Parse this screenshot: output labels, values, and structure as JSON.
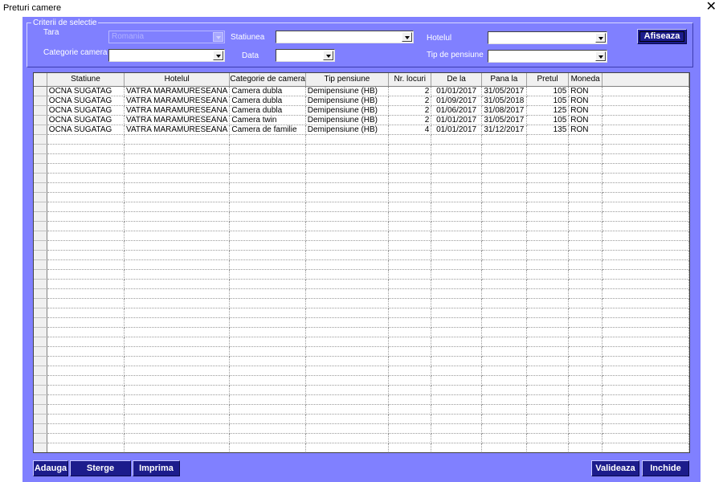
{
  "window": {
    "title": "Preturi camere"
  },
  "criteria": {
    "legend": "Criterii de selectie",
    "tara_label": "Tara",
    "tara_value": "Romania",
    "statiunea_label": "Statiunea",
    "statiunea_value": "",
    "hotelul_label": "Hotelul",
    "hotelul_value": "",
    "categorie_label": "Categorie camera",
    "categorie_value": "",
    "data_label": "Data",
    "data_value": "",
    "pensiune_label": "Tip de pensiune",
    "pensiune_value": "",
    "afiseaza_label": "Afiseaza"
  },
  "grid": {
    "columns": [
      "Statiune",
      "Hotelul",
      "Categorie de camera",
      "Tip pensiune",
      "Nr. locuri",
      "De la",
      "Pana la",
      "Pretul",
      "Moneda"
    ],
    "rows": [
      [
        "OCNA SUGATAG",
        "VATRA MARAMURESEANA",
        "Camera dubla",
        "Demipensiune (HB)",
        "2",
        "01/01/2017",
        "31/05/2017",
        "105",
        "RON"
      ],
      [
        "OCNA SUGATAG",
        "VATRA MARAMURESEANA",
        "Camera dubla",
        "Demipensiune (HB)",
        "2",
        "01/09/2017",
        "31/05/2018",
        "105",
        "RON"
      ],
      [
        "OCNA SUGATAG",
        "VATRA MARAMURESEANA",
        "Camera dubla",
        "Demipensiune (HB)",
        "2",
        "01/06/2017",
        "31/08/2017",
        "125",
        "RON"
      ],
      [
        "OCNA SUGATAG",
        "VATRA MARAMURESEANA",
        "Camera twin",
        "Demipensiune (HB)",
        "2",
        "01/01/2017",
        "31/05/2017",
        "105",
        "RON"
      ],
      [
        "OCNA SUGATAG",
        "VATRA MARAMURESEANA",
        "Camera de familie",
        "Demipensiune (HB)",
        "4",
        "01/01/2017",
        "31/12/2017",
        "135",
        "RON"
      ]
    ]
  },
  "footer": {
    "adauga_label": "Adauga",
    "sterge_label": "Sterge",
    "imprima_label": "Imprima",
    "valideaza_label": "Valideaza",
    "inchide_label": "Inchide"
  }
}
